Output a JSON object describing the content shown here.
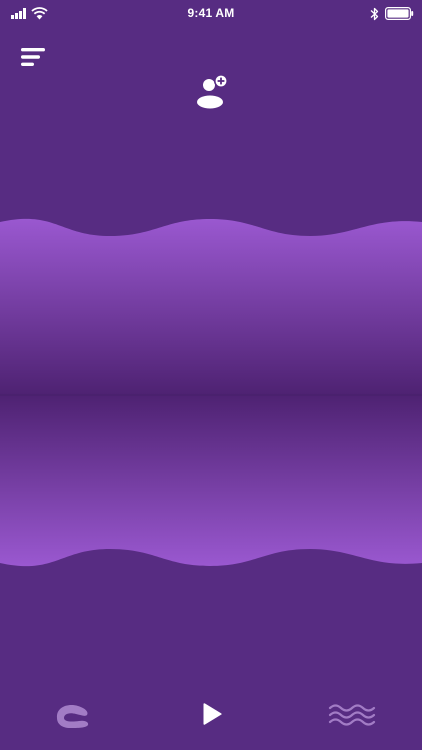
{
  "status_bar": {
    "time": "9:41 AM"
  },
  "icons": {
    "signal": "signal-icon",
    "wifi": "wifi-icon",
    "bluetooth": "bluetooth-icon",
    "battery": "battery-icon",
    "menu": "menu-icon",
    "add_user": "add-user-icon",
    "device_mode": "device-mode-icon",
    "play": "play-icon",
    "pattern": "wave-pattern-icon"
  },
  "colors": {
    "background": "#572c82",
    "wave_light": "#9a58d0",
    "wave_dark": "#4e2272",
    "icon": "#ffffff",
    "icon_muted": "#a27cc5"
  }
}
